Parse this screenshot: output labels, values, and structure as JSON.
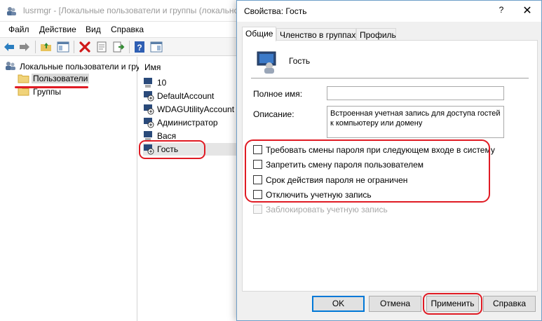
{
  "bg_window": {
    "title": "lusrmgr - [Локальные пользователи и группы (локально",
    "menu": [
      "Файл",
      "Действие",
      "Вид",
      "Справка"
    ],
    "tree": {
      "root": "Локальные пользователи и гру",
      "items": [
        "Пользователи",
        "Группы"
      ]
    },
    "list": {
      "header": "Имя",
      "items": [
        "10",
        "DefaultAccount",
        "WDAGUtilityAccount",
        "Администратор",
        "Вася",
        "Гость"
      ]
    }
  },
  "dialog": {
    "title": "Свойства: Гость",
    "help": "?",
    "close": "✕",
    "tabs": [
      "Общие",
      "Членство в группах",
      "Профиль"
    ],
    "user_name": "Гость",
    "full_name_label": "Полное имя:",
    "full_name_value": "",
    "description_label": "Описание:",
    "description_value": "Встроенная учетная запись для доступа гостей к компьютеру или домену",
    "checkboxes": [
      "Требовать смены пароля при следующем входе в систему",
      "Запретить смену пароля пользователем",
      "Срок действия пароля не ограничен",
      "Отключить учетную запись",
      "Заблокировать учетную запись"
    ],
    "buttons": {
      "ok": "OK",
      "cancel": "Отмена",
      "apply": "Применить",
      "help": "Справка"
    }
  },
  "colors": {
    "highlight": "#e01b24",
    "accent": "#0078d7"
  }
}
